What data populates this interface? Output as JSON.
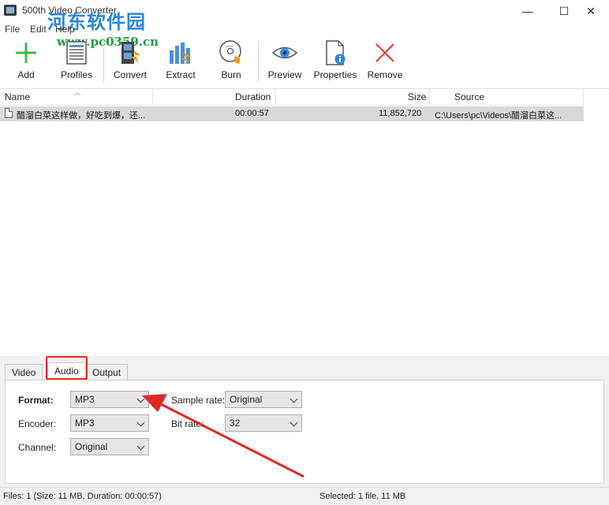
{
  "window": {
    "title": "500th Video Converter",
    "watermark": "河东软件园",
    "watermark_url": "www.pc0359.cn",
    "controls": {
      "minimize": "—",
      "maximize": "☐",
      "close": "✕"
    }
  },
  "menu": {
    "items": [
      "File",
      "Edit",
      "Help"
    ]
  },
  "toolbar": {
    "items": [
      {
        "label": "Add",
        "icon": "add-icon"
      },
      {
        "label": "Profiles",
        "icon": "profiles-icon"
      },
      {
        "label": "Convert",
        "icon": "convert-icon"
      },
      {
        "label": "Extract",
        "icon": "extract-icon"
      },
      {
        "label": "Burn",
        "icon": "burn-icon"
      },
      {
        "label": "Preview",
        "icon": "preview-icon"
      },
      {
        "label": "Properties",
        "icon": "properties-icon"
      },
      {
        "label": "Remove",
        "icon": "remove-icon"
      }
    ]
  },
  "file_list": {
    "columns": {
      "name": "Name",
      "duration": "Duration",
      "size": "Size",
      "source": "Source"
    },
    "rows": [
      {
        "name": "醋溜白菜这样做，好吃到爆，还...",
        "duration": "00:00:57",
        "size": "11,852,720",
        "source": "C:\\Users\\pc\\Videos\\醋溜白菜这..."
      }
    ]
  },
  "tabs": {
    "video": "Video",
    "audio": "Audio",
    "output": "Output",
    "active": "Audio"
  },
  "audio_settings": {
    "format_label": "Format:",
    "format_value": "MP3",
    "encoder_label": "Encoder:",
    "encoder_value": "MP3",
    "channel_label": "Channel:",
    "channel_value": "Original",
    "sample_rate_label": "Sample rate:",
    "sample_rate_value": "Original",
    "bit_rate_label": "Bit rate:",
    "bit_rate_value": "32"
  },
  "status": {
    "files": "Files: 1 (Size: 11 MB, Duration: 00:00:57)",
    "selected": "Selected: 1 file, 11 MB"
  },
  "colors": {
    "annotation_red": "#e22828",
    "selection_gray": "#d9d9d9",
    "watermark_blue": "#2a87d8",
    "watermark_green": "#1d9a3e"
  }
}
